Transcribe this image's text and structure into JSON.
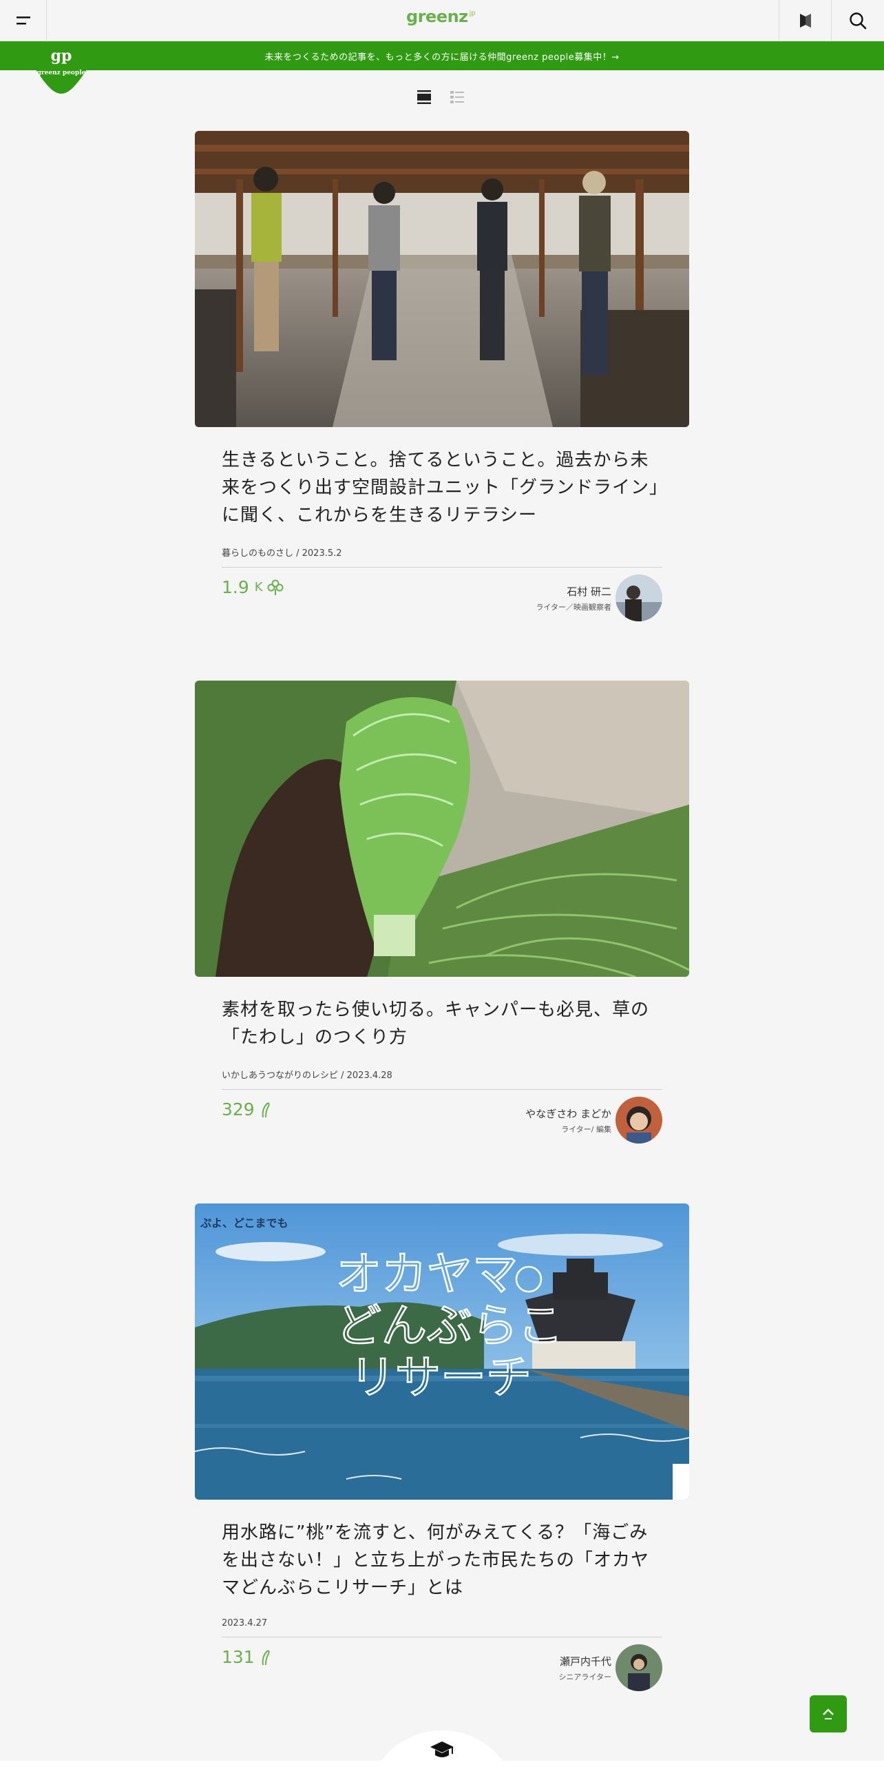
{
  "header": {
    "logo": "greenz",
    "logo_suffix": "jp",
    "menu_icon": "hamburger-icon",
    "bookmark_icon": "bookmark-icon",
    "search_icon": "search-icon"
  },
  "banner": {
    "text": "未来をつくるための記事を、もっと多くの方に届ける仲間greenz people募集中！→",
    "badge_mark": "gp",
    "badge_sub": "greenz people",
    "color": "#2f9a12"
  },
  "view_toggle": {
    "options": [
      "card-view",
      "list-view"
    ],
    "active": "card-view"
  },
  "articles": [
    {
      "title": "生きるということ。捨てるということ。過去から未来をつくり出す空間設計ユニット「グランドライン」に聞く、これからを生きるリテラシー",
      "meta": "暮らしのものさし / 2023.5.2",
      "count": "1.9",
      "count_suffix": "K",
      "count_icon": "clover-icon",
      "author_name": "石村 研二",
      "author_role": "ライター／映画観察者"
    },
    {
      "title": "素材を取ったら使い切る。キャンパーも必見、草の「たわし」のつくり方",
      "meta": "いかしあうつながりのレシピ / 2023.4.28",
      "count": "329",
      "count_suffix": "",
      "count_icon": "sprout-icon",
      "author_name": "やなぎさわ まどか",
      "author_role": "ライター/ 編集"
    },
    {
      "title": "用水路に”桃”を流すと、何がみえてくる？「海ごみを出さない！」と立ち上がった市民たちの「オカヤマどんぶらこリサーチ」とは",
      "meta": "2023.4.27",
      "count": "131",
      "count_suffix": "",
      "count_icon": "sprout-icon",
      "author_name": "瀬戸内千代",
      "author_role": "シニアライター"
    }
  ],
  "okayama_image": {
    "caption_top": "ぷよ、どこまでも",
    "line1": "オカヤマ",
    "line2": "どんぶらこ",
    "line3": "リサーチ"
  },
  "page_top_icon": "chevron-up-icon",
  "footer_icon": "graduation-cap-icon"
}
